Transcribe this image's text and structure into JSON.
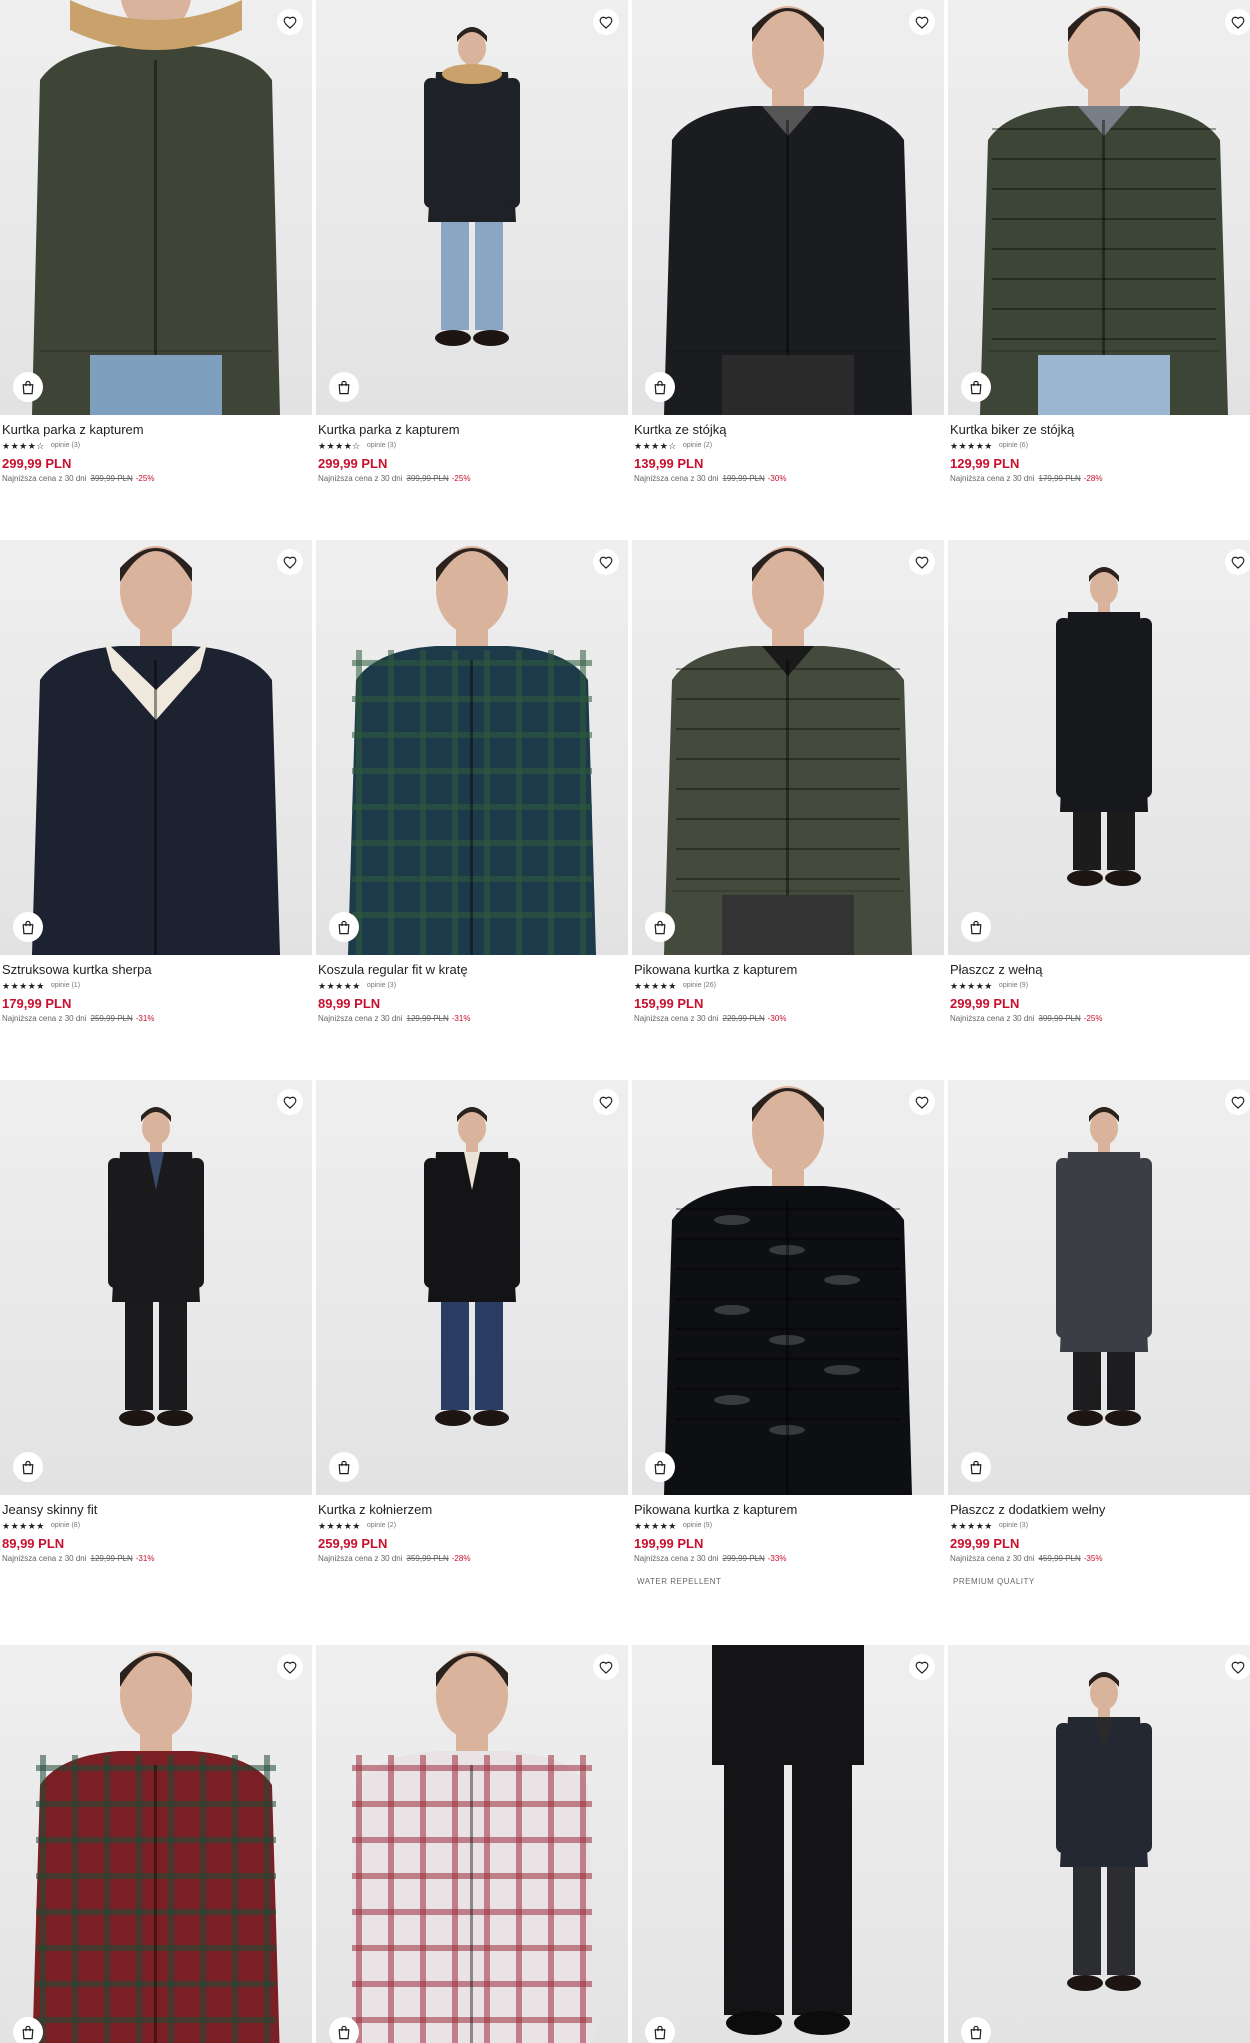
{
  "products": [
    {
      "title": "Kurtka parka z kapturem",
      "stars": "★★★★☆",
      "reviews": "opinie (3)",
      "price": "299,99 PLN",
      "lowest_label": "Najniższa cena z 30 dni",
      "old_price": "399,99 PLN",
      "discount": "-25%",
      "tag": "",
      "image": "model-dark-green-fur-hooded-parka"
    },
    {
      "title": "Kurtka parka z kapturem",
      "stars": "★★★★☆",
      "reviews": "opinie (3)",
      "price": "299,99 PLN",
      "lowest_label": "Najniższa cena z 30 dni",
      "old_price": "399,99 PLN",
      "discount": "-25%",
      "tag": "",
      "image": "model-black-fur-hooded-parka"
    },
    {
      "title": "Kurtka ze stójką",
      "stars": "★★★★☆",
      "reviews": "opinie (2)",
      "price": "139,99 PLN",
      "lowest_label": "Najniższa cena z 30 dni",
      "old_price": "199,99 PLN",
      "discount": "-30%",
      "tag": "",
      "image": "model-black-stand-collar-jacket"
    },
    {
      "title": "Kurtka biker ze stójką",
      "stars": "★★★★★",
      "reviews": "opinie (6)",
      "price": "129,99 PLN",
      "lowest_label": "Najniższa cena z 30 dni",
      "old_price": "179,99 PLN",
      "discount": "-28%",
      "tag": "",
      "image": "model-green-quilted-biker-jacket"
    },
    {
      "title": "Sztruksowa kurtka sherpa",
      "stars": "★★★★★",
      "reviews": "opinie (1)",
      "price": "179,99 PLN",
      "lowest_label": "Najniższa cena z 30 dni",
      "old_price": "259,99 PLN",
      "discount": "-31%",
      "tag": "",
      "image": "model-navy-corduroy-sherpa-jacket"
    },
    {
      "title": "Koszula regular fit w kratę",
      "stars": "★★★★★",
      "reviews": "opinie (3)",
      "price": "89,99 PLN",
      "lowest_label": "Najniższa cena z 30 dni",
      "old_price": "129,99 PLN",
      "discount": "-31%",
      "tag": "",
      "image": "model-green-tartan-shirt"
    },
    {
      "title": "Pikowana kurtka z kapturem",
      "stars": "★★★★★",
      "reviews": "opinie (26)",
      "price": "159,99 PLN",
      "lowest_label": "Najniższa cena z 30 dni",
      "old_price": "229,99 PLN",
      "discount": "-30%",
      "tag": "",
      "image": "model-olive-puffer-hooded-jacket"
    },
    {
      "title": "Płaszcz z wełną",
      "stars": "★★★★★",
      "reviews": "opinie (9)",
      "price": "299,99 PLN",
      "lowest_label": "Najniższa cena z 30 dni",
      "old_price": "399,99 PLN",
      "discount": "-25%",
      "tag": "",
      "image": "model-black-wool-coat"
    },
    {
      "title": "Jeansy skinny fit",
      "stars": "★★★★★",
      "reviews": "opinie (8)",
      "price": "89,99 PLN",
      "lowest_label": "Najniższa cena z 30 dni",
      "old_price": "129,99 PLN",
      "discount": "-31%",
      "tag": "",
      "image": "model-black-jacket-black-jeans"
    },
    {
      "title": "Kurtka z kołnierzem",
      "stars": "★★★★★",
      "reviews": "opinie (2)",
      "price": "259,99 PLN",
      "lowest_label": "Najniższa cena z 30 dni",
      "old_price": "359,99 PLN",
      "discount": "-28%",
      "tag": "",
      "image": "model-black-leather-shearling-jacket"
    },
    {
      "title": "Pikowana kurtka z kapturem",
      "stars": "★★★★★",
      "reviews": "opinie (9)",
      "price": "199,99 PLN",
      "lowest_label": "Najniższa cena z 30 dni",
      "old_price": "299,99 PLN",
      "discount": "-33%",
      "tag": "WATER REPELLENT",
      "image": "model-glossy-black-puffer-jacket"
    },
    {
      "title": "Płaszcz z dodatkiem wełny",
      "stars": "★★★★★",
      "reviews": "opinie (3)",
      "price": "299,99 PLN",
      "lowest_label": "Najniższa cena z 30 dni",
      "old_price": "459,99 PLN",
      "discount": "-35%",
      "tag": "PREMIUM QUALITY",
      "image": "model-grey-wool-blend-coat"
    },
    {
      "title": "",
      "stars": "",
      "reviews": "",
      "price": "",
      "lowest_label": "",
      "old_price": "",
      "discount": "",
      "tag": "",
      "image": "model-red-green-tartan-shirt"
    },
    {
      "title": "",
      "stars": "",
      "reviews": "",
      "price": "",
      "lowest_label": "",
      "old_price": "",
      "discount": "",
      "tag": "",
      "image": "model-red-white-check-shirt"
    },
    {
      "title": "",
      "stars": "",
      "reviews": "",
      "price": "",
      "lowest_label": "",
      "old_price": "",
      "discount": "",
      "tag": "",
      "image": "model-black-jogger-trousers"
    },
    {
      "title": "",
      "stars": "",
      "reviews": "",
      "price": "",
      "lowest_label": "",
      "old_price": "",
      "discount": "",
      "tag": "",
      "image": "model-navy-bomber-jacket"
    }
  ],
  "icons": {
    "wishlist": "heart-icon",
    "add_to_bag": "shopping-bag-icon"
  },
  "colors": {
    "price": "#c8102e",
    "discount": "#c8102e",
    "background": "#ffffff"
  }
}
